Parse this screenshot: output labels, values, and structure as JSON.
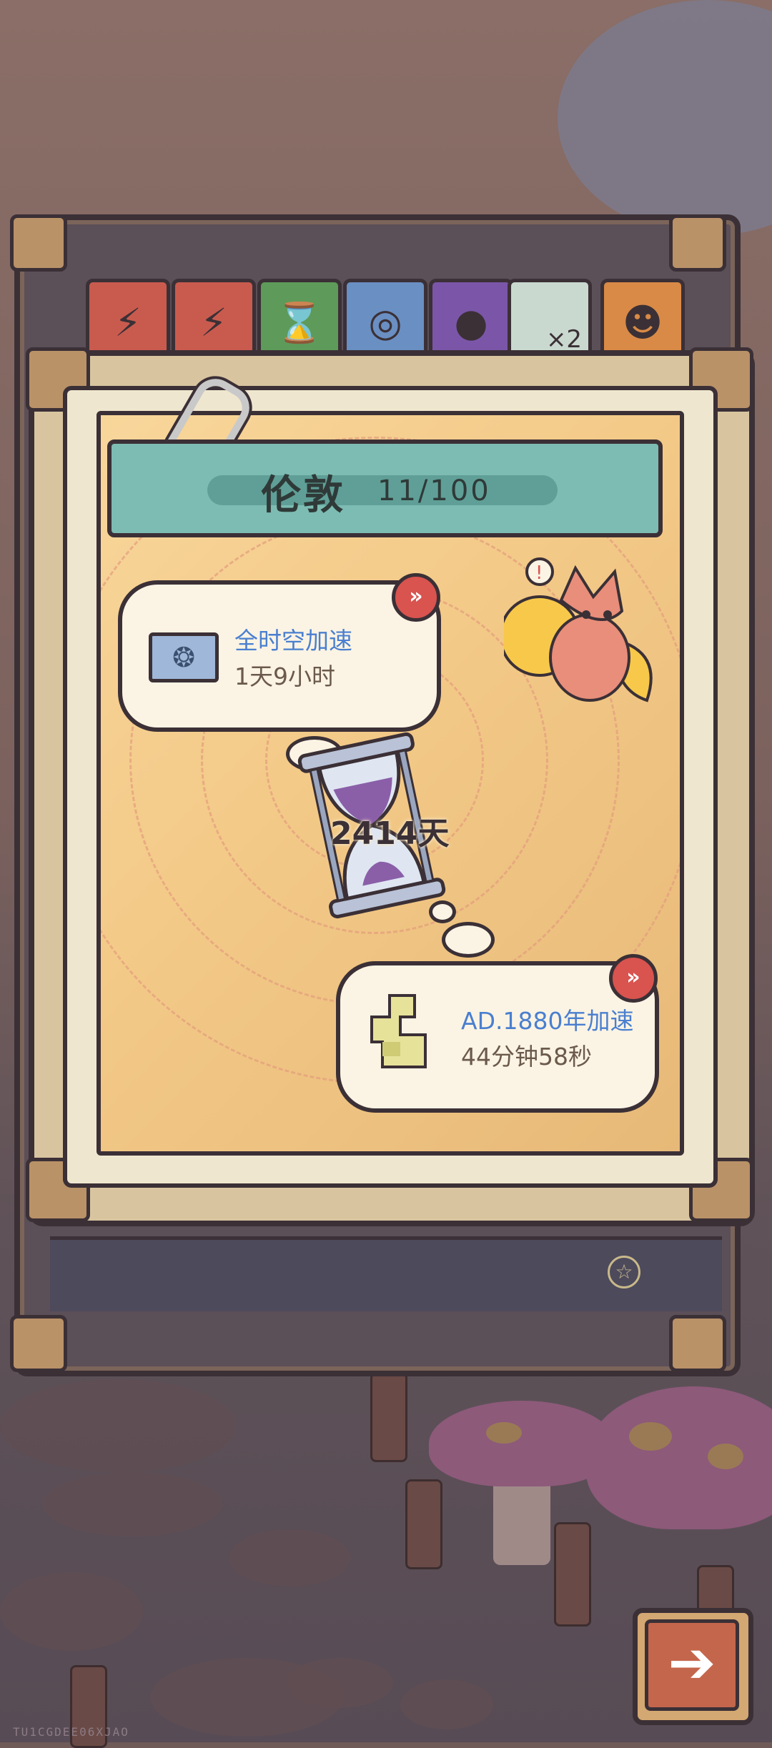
{
  "city": {
    "name": "伦敦",
    "progress": "11/100"
  },
  "bubble_top": {
    "title": "全时空加速",
    "time": "1天9小时",
    "icon": "vortex-icon"
  },
  "bubble_bottom": {
    "title": "AD.1880年加速",
    "time": "44分钟58秒",
    "icon": "map-icon"
  },
  "hourglass": {
    "days": "2414天"
  },
  "watermark": "TU1CGDEE06XJAO",
  "tabs": [
    {
      "icon": "battery-icon",
      "color": "#c95b4e"
    },
    {
      "icon": "battery-icon",
      "color": "#c95b4e"
    },
    {
      "icon": "hourglass-icon",
      "color": "#5e9a5a"
    },
    {
      "icon": "portal-icon",
      "color": "#6a8fc2"
    },
    {
      "icon": "tadpole-icon",
      "color": "#7b56a8"
    },
    {
      "icon": "potion-x2-icon",
      "color": "#c9d9cf",
      "label": "×2"
    },
    {
      "icon": "ghost-icon",
      "color": "#d98a46"
    }
  ],
  "colors": {
    "accent_red": "#d9534f",
    "title_bar": "#7dbcb3",
    "link_blue": "#4a7fd0"
  }
}
